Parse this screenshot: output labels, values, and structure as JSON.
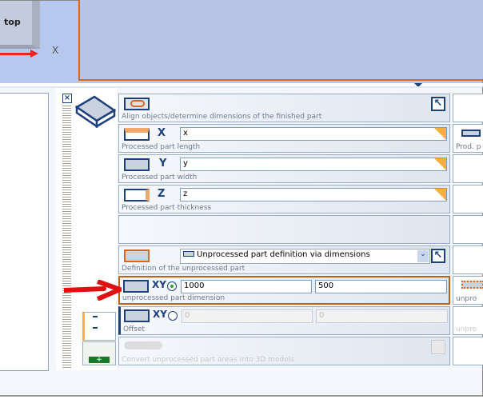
{
  "viewport": {
    "cube_label": "top",
    "axis_label": "X"
  },
  "rows": {
    "align": {
      "label": "Align objects/determine dimensions of the finished part"
    },
    "length": {
      "axis": "X",
      "value": "x",
      "label": "Processed part length",
      "side_label": "Prod. p"
    },
    "width": {
      "axis": "Y",
      "value": "y",
      "label": "Processed part width"
    },
    "thickness": {
      "axis": "Z",
      "value": "z",
      "label": "Processed part thickness"
    },
    "definition": {
      "label": "Definition of the unprocessed part",
      "select_value": "Unprocessed part definition via dimensions"
    },
    "dimension": {
      "axis": "XY",
      "x_value": "1000",
      "y_value": "500",
      "label": "unprocessed part dimension",
      "side_label": "unpro",
      "selected": true
    },
    "offset": {
      "axis": "XY",
      "x_value": "0",
      "y_value": "0",
      "label": "Offset",
      "side_label": "unpro",
      "selected": false
    },
    "convert": {
      "label": "Convert unprocessed part areas into 3D models"
    }
  },
  "colors": {
    "accent": "#d9691a",
    "brand": "#1d3f7a",
    "field_marker": "#f4b13c",
    "arrow": "#e01010"
  }
}
